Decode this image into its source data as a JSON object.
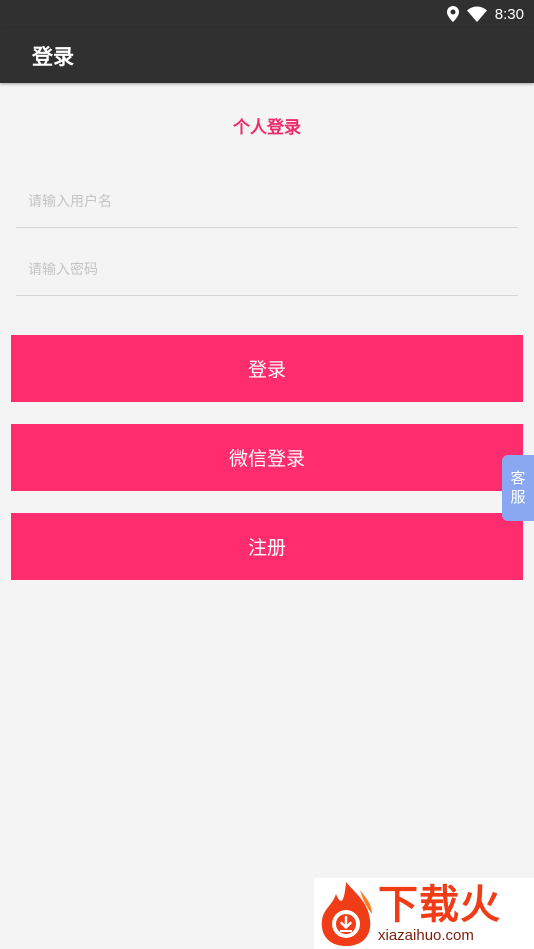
{
  "status_bar": {
    "time": "8:30",
    "icons": [
      "location-icon",
      "wifi-icon"
    ]
  },
  "app_bar": {
    "title": "登录"
  },
  "form": {
    "section_title": "个人登录",
    "username": {
      "placeholder": "请输入用户名",
      "value": ""
    },
    "password": {
      "placeholder": "请输入密码",
      "value": ""
    }
  },
  "buttons": {
    "login": "登录",
    "wechat_login": "微信登录",
    "register": "注册"
  },
  "service_tab": {
    "line1": "客",
    "line2": "服"
  },
  "watermark": {
    "brand": "下载火",
    "domain": "xiazaihuo.com"
  },
  "colors": {
    "accent": "#ff2d6e",
    "title_accent": "#ef2b6c",
    "app_bar": "#303030",
    "background": "#f4f4f4",
    "service_tab": "#8aa7f2"
  }
}
